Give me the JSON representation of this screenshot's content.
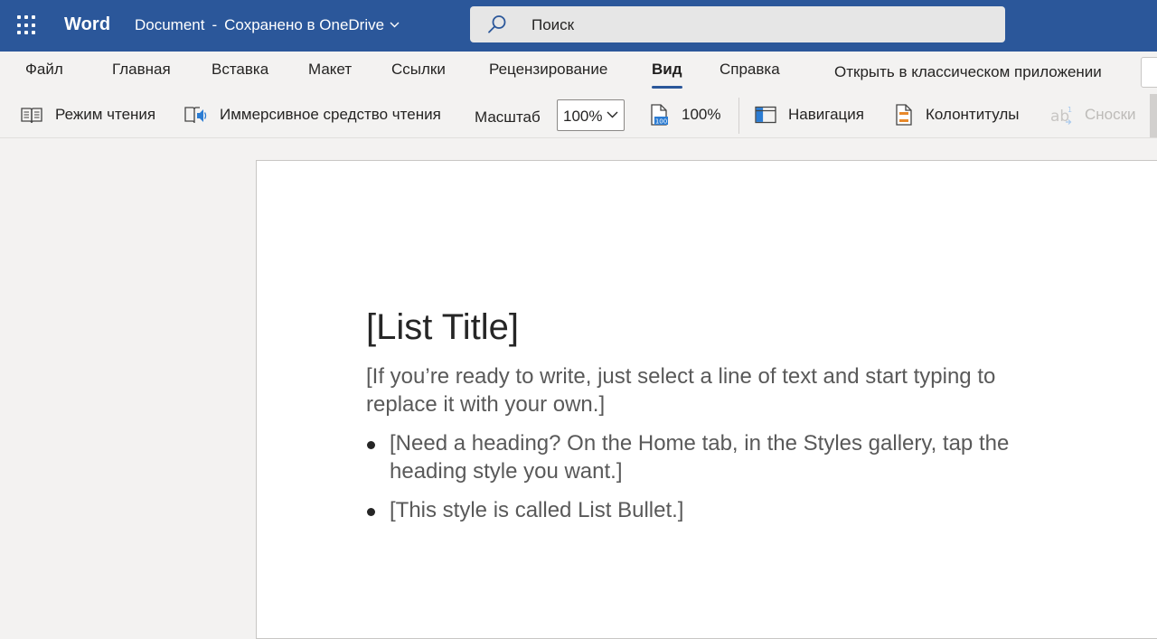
{
  "header": {
    "app_name": "Word",
    "doc_name": "Document",
    "separator": "-",
    "save_status": "Сохранено в OneDrive",
    "search_placeholder": "Поиск"
  },
  "tabs": [
    {
      "label": "Файл"
    },
    {
      "label": "Главная"
    },
    {
      "label": "Вставка"
    },
    {
      "label": "Макет"
    },
    {
      "label": "Ссылки"
    },
    {
      "label": "Рецензирование"
    },
    {
      "label": "Вид",
      "active": true
    },
    {
      "label": "Справка"
    }
  ],
  "open_classic_label": "Открыть в классическом приложении",
  "toolbar": {
    "reading_mode": "Режим чтения",
    "immersive_reader": "Иммерсивное средство чтения",
    "zoom_label": "Масштаб",
    "zoom_value": "100%",
    "zoom_100": "100%",
    "navigation": "Навигация",
    "headers_footers": "Колонтитулы",
    "footnotes": "Сноски"
  },
  "document": {
    "title": "[List Title]",
    "intro": "[If you’re ready to write, just select a line of text and start typing to replace it with your own.]",
    "bullets": [
      "[Need a heading? On the Home tab, in the Styles gallery, tap the heading style you want.]",
      "[This style is called List Bullet.]"
    ]
  },
  "colors": {
    "titlebar": "#2b579a",
    "accent": "#2b579a",
    "canvas": "#f3f2f1"
  },
  "icons": {
    "app_launcher": "waffle-icon",
    "search": "search-icon",
    "reading_mode": "book-open-icon",
    "immersive_reader": "immersive-reader-icon",
    "zoom_100": "page-100-icon",
    "navigation": "navigation-pane-icon",
    "headers_footers": "header-footer-icon",
    "footnotes": "footnote-icon"
  }
}
